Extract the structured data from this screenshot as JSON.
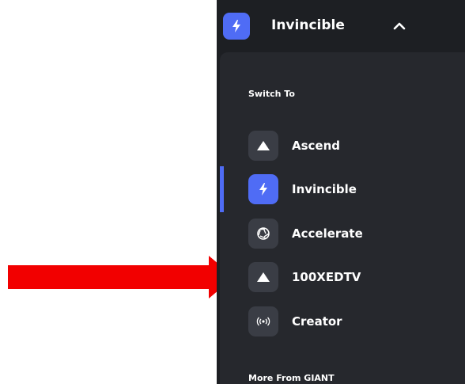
{
  "header": {
    "title": "Invincible",
    "icon": "bolt-icon",
    "chevron": "chevron-up-icon"
  },
  "menu": {
    "switch_to_label": "Switch To",
    "items": [
      {
        "label": "Ascend",
        "icon": "mountain-icon",
        "active": false
      },
      {
        "label": "Invincible",
        "icon": "bolt-icon",
        "active": true
      },
      {
        "label": "Accelerate",
        "icon": "aperture-icon",
        "active": false
      },
      {
        "label": "100XEDTV",
        "icon": "mountain-icon",
        "active": false
      },
      {
        "label": "Creator",
        "icon": "broadcast-icon",
        "active": false
      }
    ],
    "more_label": "More From GIANT"
  },
  "annotation": {
    "arrow_color": "#f20000",
    "arrow_target": "100XEDTV"
  },
  "colors": {
    "accent": "#4f6cf5",
    "panel_bg": "#1d1f23",
    "menu_bg": "#26282d",
    "icon_bg": "#3a3d45"
  }
}
